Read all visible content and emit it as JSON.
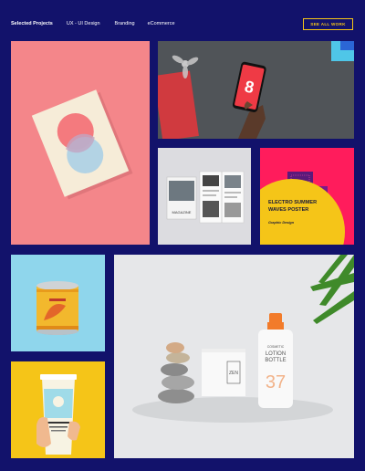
{
  "nav": {
    "items": [
      {
        "label": "Selected Projects",
        "active": true
      },
      {
        "label": "UX - UI Design",
        "active": false
      },
      {
        "label": "Branding",
        "active": false
      },
      {
        "label": "eCommerce",
        "active": false
      }
    ]
  },
  "cta": {
    "label": "SEE ALL WORK"
  },
  "projects": {
    "booklet": {
      "icon": "booklet-mockup"
    },
    "phone": {
      "icon": "phone-mockup",
      "app_glyph": "8"
    },
    "magazine": {
      "icon": "magazine-mockup",
      "cover_text": "MAGAZINE"
    },
    "poster": {
      "title_line1": "ELECTRO SUMMER",
      "title_line2": "WAVES POSTER",
      "subtitle": "Graphic Design"
    },
    "can": {
      "icon": "tin-can-mockup"
    },
    "cup": {
      "icon": "coffee-cup-mockup"
    },
    "cosmetic": {
      "bottle_line1": "COSMETIC",
      "bottle_line2": "LOTION",
      "bottle_line3": "BOTTLE",
      "number": "37",
      "box_text": "ZEN"
    }
  },
  "colors": {
    "background": "#12126b",
    "accent": "#f5c518",
    "poster_bg": "#ff1c5c",
    "coral": "#f4868a"
  }
}
